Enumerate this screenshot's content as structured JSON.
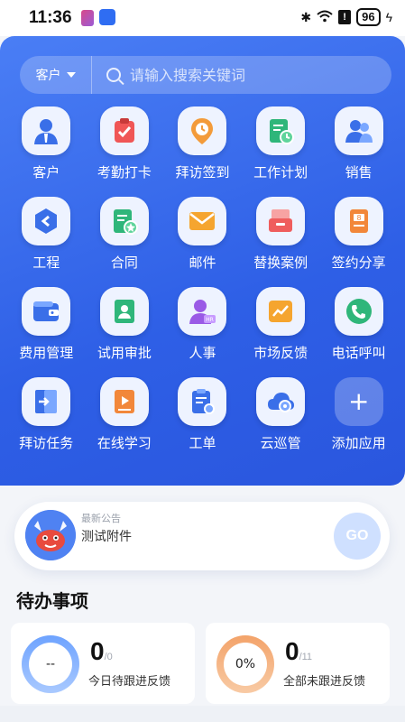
{
  "status_bar": {
    "time": "11:36",
    "battery": "96",
    "alert": "!"
  },
  "search": {
    "type_label": "客户",
    "placeholder": "请输入搜索关键词"
  },
  "apps": [
    {
      "label": "客户",
      "icon": "customer-icon"
    },
    {
      "label": "考勤打卡",
      "icon": "attendance-icon"
    },
    {
      "label": "拜访签到",
      "icon": "visit-checkin-icon"
    },
    {
      "label": "工作计划",
      "icon": "work-plan-icon"
    },
    {
      "label": "销售",
      "icon": "sales-icon"
    },
    {
      "label": "工程",
      "icon": "engineering-icon"
    },
    {
      "label": "合同",
      "icon": "contract-icon"
    },
    {
      "label": "邮件",
      "icon": "mail-icon"
    },
    {
      "label": "替换案例",
      "icon": "replacement-case-icon"
    },
    {
      "label": "签约分享",
      "icon": "signing-share-icon"
    },
    {
      "label": "费用管理",
      "icon": "expense-icon"
    },
    {
      "label": "试用审批",
      "icon": "trial-approval-icon"
    },
    {
      "label": "人事",
      "icon": "hr-icon"
    },
    {
      "label": "市场反馈",
      "icon": "market-feedback-icon"
    },
    {
      "label": "电话呼叫",
      "icon": "phone-icon"
    },
    {
      "label": "拜访任务",
      "icon": "visit-task-icon"
    },
    {
      "label": "在线学习",
      "icon": "online-learning-icon"
    },
    {
      "label": "工单",
      "icon": "work-order-icon"
    },
    {
      "label": "云巡管",
      "icon": "cloud-patrol-icon"
    },
    {
      "label": "添加应用",
      "icon": "plus-icon",
      "plus_glyph": "+"
    }
  ],
  "notice": {
    "title": "最新公告",
    "text": "测试附件",
    "button": "GO"
  },
  "todo": {
    "title": "待办事项",
    "cards": [
      {
        "count": "0",
        "total": "/0",
        "label": "今日待跟进反馈",
        "ring_text": "--"
      },
      {
        "count": "0",
        "total": "/11",
        "label": "全部未跟进反馈",
        "ring_text": "0%"
      }
    ]
  }
}
